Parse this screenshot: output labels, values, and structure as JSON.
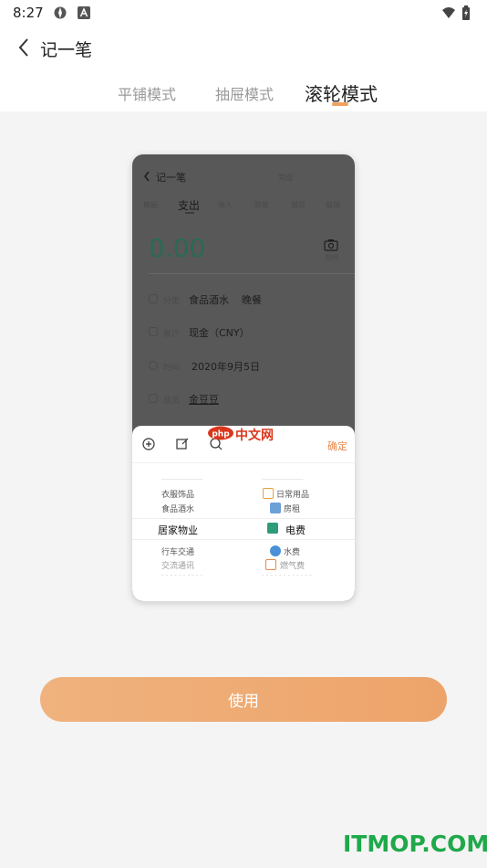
{
  "status_bar": {
    "time": "8:27"
  },
  "header": {
    "title": "记一笔"
  },
  "modes": [
    {
      "label": "平铺模式"
    },
    {
      "label": "抽屉模式"
    },
    {
      "label": "滚轮模式",
      "active": true
    }
  ],
  "preview": {
    "title": "记一笔",
    "top_right": "完成",
    "tabs": [
      "模板",
      "支出",
      "收入",
      "转账",
      "借贷",
      "报销"
    ],
    "active_tab": "支出",
    "amount": "0.00",
    "camera_label": "拍照",
    "rows": [
      {
        "label": "分类",
        "value": "食品酒水",
        "value2": "晚餐"
      },
      {
        "label": "账户",
        "value": "现金（CNY）"
      },
      {
        "label": "时间",
        "value": "2020年9月5日"
      },
      {
        "label": "成员",
        "value": "金豆豆"
      }
    ],
    "sheet": {
      "confirm": "确定",
      "categories_left": [
        "衣服饰品",
        "食品酒水",
        "居家物业",
        "行车交通",
        "交流通讯"
      ],
      "categories_right": [
        "日常用品",
        "房租",
        "电费",
        "水费",
        "燃气费"
      ]
    }
  },
  "watermark": {
    "text": "中文网",
    "logo": "php"
  },
  "use_button": {
    "label": "使用"
  },
  "brand": {
    "text": "ITMOP.COM"
  },
  "colors": {
    "accent": "#eda46a",
    "amount": "#2a6a52",
    "brand_green": "#1fa94a",
    "confirm": "#e8874a"
  }
}
